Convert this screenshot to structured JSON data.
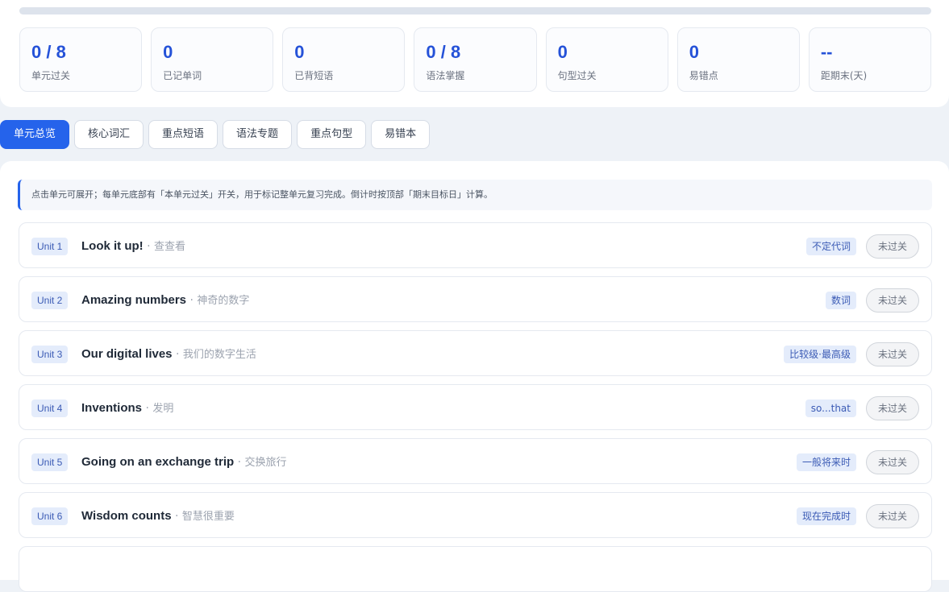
{
  "progress": {
    "percent": 0,
    "colors": {
      "track": "#dde3ec",
      "fill": "#2563eb"
    }
  },
  "stats": [
    {
      "value": "0 / 8",
      "label": "单元过关"
    },
    {
      "value": "0",
      "label": "已记单词"
    },
    {
      "value": "0",
      "label": "已背短语"
    },
    {
      "value": "0 / 8",
      "label": "语法掌握"
    },
    {
      "value": "0",
      "label": "句型过关"
    },
    {
      "value": "0",
      "label": "易错点"
    },
    {
      "value": "--",
      "label": "距期末(天)"
    }
  ],
  "tabs": [
    {
      "label": "单元总览",
      "active": true
    },
    {
      "label": "核心词汇",
      "active": false
    },
    {
      "label": "重点短语",
      "active": false
    },
    {
      "label": "语法专题",
      "active": false
    },
    {
      "label": "重点句型",
      "active": false
    },
    {
      "label": "易错本",
      "active": false
    }
  ],
  "hint": "点击单元可展开；每单元底部有「本单元过关」开关，用于标记整单元复习完成。倒计时按顶部「期末目标日」计算。",
  "units": [
    {
      "badge": "Unit 1",
      "title_en": "Look it up!",
      "title_cn": "查查看",
      "grammar": "不定代词",
      "status": "未过关"
    },
    {
      "badge": "Unit 2",
      "title_en": "Amazing numbers",
      "title_cn": "神奇的数字",
      "grammar": "数词",
      "status": "未过关"
    },
    {
      "badge": "Unit 3",
      "title_en": "Our digital lives",
      "title_cn": "我们的数字生活",
      "grammar": "比较级·最高级",
      "status": "未过关"
    },
    {
      "badge": "Unit 4",
      "title_en": "Inventions",
      "title_cn": "发明",
      "grammar": "so...that",
      "status": "未过关"
    },
    {
      "badge": "Unit 5",
      "title_en": "Going on an exchange trip",
      "title_cn": "交换旅行",
      "grammar": "一般将来时",
      "status": "未过关"
    },
    {
      "badge": "Unit 6",
      "title_en": "Wisdom counts",
      "title_cn": "智慧很重要",
      "grammar": "现在完成时",
      "status": "未过关"
    }
  ],
  "separator": " · ",
  "colors": {
    "accent": "#2563eb",
    "stat_value": "#2552d8",
    "tag_bg": "#e4ecfb",
    "tag_text": "#3b5bb5"
  }
}
